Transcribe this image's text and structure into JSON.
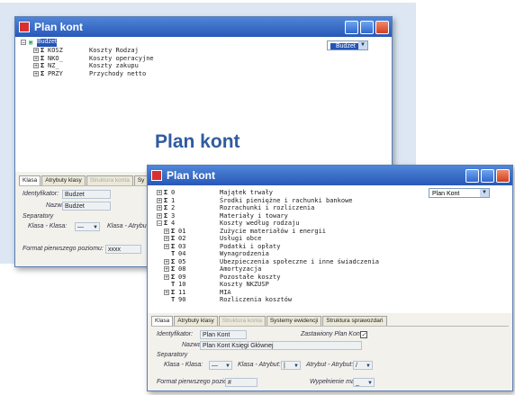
{
  "heading": "Plan kont",
  "back": {
    "title": "Plan kont",
    "root": "Budżet",
    "rows": [
      {
        "code": "KOSZ",
        "name": "Koszty Rodzaj"
      },
      {
        "code": "NKO_",
        "name": "Koszty operacyjne"
      },
      {
        "code": "NZ_",
        "name": "Koszty zakupu"
      },
      {
        "code": "PRZY",
        "name": "Przychody netto"
      }
    ],
    "combo": "Budżet",
    "tabs": [
      "Klasa",
      "Atrybuty klasy",
      "Struktura konta",
      "Sy"
    ],
    "id_label": "Identyfikator:",
    "id_value": "Budzet",
    "name_label": "Nazwa:",
    "name_value": "Budżet",
    "sep_label": "Separatory",
    "klasa_label": "Klasa - Klasa:",
    "klasa_value": "—",
    "attr_label": "Klasa - Atrybut:",
    "format_label": "Format pierwszego poziomu:",
    "format_value": "xxxx"
  },
  "front": {
    "title": "Plan kont",
    "combo": "Plan Kont",
    "rows": [
      {
        "code": "0",
        "name": "Majątek trwały",
        "lvl": 0,
        "ex": "+"
      },
      {
        "code": "1",
        "name": "Środki pieniężne i rachunki bankowe",
        "lvl": 0,
        "ex": "+"
      },
      {
        "code": "2",
        "name": "Rozrachunki i rozliczenia",
        "lvl": 0,
        "ex": "+"
      },
      {
        "code": "3",
        "name": "Materiały i towary",
        "lvl": 0,
        "ex": "+"
      },
      {
        "code": "4",
        "name": "Koszty według rodzaju",
        "lvl": 0,
        "ex": "−"
      },
      {
        "code": "01",
        "name": "Zużycie materiałów i energii",
        "lvl": 1,
        "ex": "+"
      },
      {
        "code": "02",
        "name": "Usługi obce",
        "lvl": 1,
        "ex": "+"
      },
      {
        "code": "03",
        "name": "Podatki i opłaty",
        "lvl": 1,
        "ex": "+"
      },
      {
        "code": "04",
        "name": "Wynagrodzenia",
        "lvl": 1,
        "ex": ""
      },
      {
        "code": "05",
        "name": "Ubezpieczenia społeczne i inne świadczenia",
        "lvl": 1,
        "ex": "+"
      },
      {
        "code": "08",
        "name": "Amortyzacja",
        "lvl": 1,
        "ex": "+"
      },
      {
        "code": "09",
        "name": "Pozostałe koszty",
        "lvl": 1,
        "ex": "+"
      },
      {
        "code": "10",
        "name": "Koszty NKZUSP",
        "lvl": 1,
        "ex": ""
      },
      {
        "code": "11",
        "name": "MIA",
        "lvl": 1,
        "ex": "+"
      },
      {
        "code": "90",
        "name": "Rozliczenia kosztów",
        "lvl": 1,
        "ex": ""
      }
    ],
    "tabs": [
      "Klasa",
      "Atrybuty klasy",
      "Struktura konta",
      "Systemy ewidencji",
      "Struktura sprawozdań"
    ],
    "id_label": "Identyfikator:",
    "id_value": "Plan Kont",
    "default_label": "Zastawiony Plan Kont:",
    "name_label": "Nazwa:",
    "name_value": "Plan Kont Księgi Głównej",
    "sep_label": "Separatory",
    "klasa_label": "Klasa - Klasa:",
    "klasa_value": "—",
    "attr_label": "Klasa - Atrybut:",
    "attr_value": "|",
    "attr2_label": "Atrybut - Atrybut:",
    "attr2_value": "/",
    "format_label": "Format pierwszego poziomu:",
    "format_value": "#",
    "mask_label": "Wypełnienie maski:",
    "mask_value": "_"
  }
}
